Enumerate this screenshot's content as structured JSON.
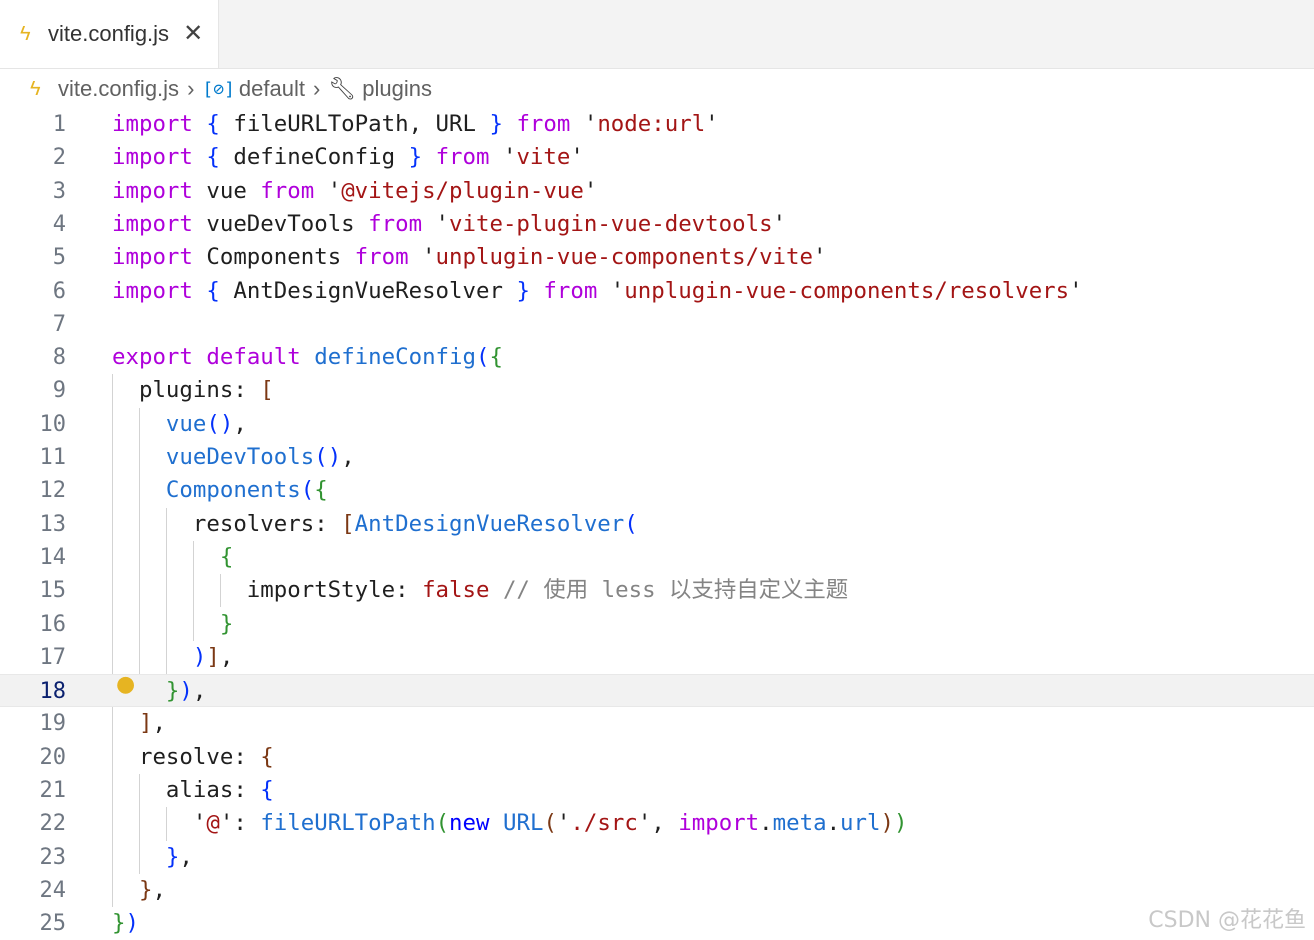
{
  "tab": {
    "label": "vite.config.js",
    "close_glyph": "✕"
  },
  "breadcrumb": {
    "file": "vite.config.js",
    "symbol": "default",
    "member": "plugins"
  },
  "editor": {
    "active_line": 18,
    "lines": [
      [
        [
          "kw",
          "import"
        ],
        [
          "plain",
          " "
        ],
        [
          "br1",
          "{"
        ],
        [
          "plain",
          " fileURLToPath, URL "
        ],
        [
          "br1",
          "}"
        ],
        [
          "plain",
          " "
        ],
        [
          "kw",
          "from"
        ],
        [
          "plain",
          " '"
        ],
        [
          "str",
          "node:url"
        ],
        [
          "plain",
          "'"
        ]
      ],
      [
        [
          "kw",
          "import"
        ],
        [
          "plain",
          " "
        ],
        [
          "br1",
          "{"
        ],
        [
          "plain",
          " defineConfig "
        ],
        [
          "br1",
          "}"
        ],
        [
          "plain",
          " "
        ],
        [
          "kw",
          "from"
        ],
        [
          "plain",
          " '"
        ],
        [
          "str",
          "vite"
        ],
        [
          "plain",
          "'"
        ]
      ],
      [
        [
          "kw",
          "import"
        ],
        [
          "plain",
          " vue "
        ],
        [
          "kw",
          "from"
        ],
        [
          "plain",
          " '"
        ],
        [
          "str",
          "@vitejs/plugin-vue"
        ],
        [
          "plain",
          "'"
        ]
      ],
      [
        [
          "kw",
          "import"
        ],
        [
          "plain",
          " vueDevTools "
        ],
        [
          "kw",
          "from"
        ],
        [
          "plain",
          " '"
        ],
        [
          "str",
          "vite-plugin-vue-devtools"
        ],
        [
          "plain",
          "'"
        ]
      ],
      [
        [
          "kw",
          "import"
        ],
        [
          "plain",
          " Components "
        ],
        [
          "kw",
          "from"
        ],
        [
          "plain",
          " '"
        ],
        [
          "str",
          "unplugin-vue-components/vite"
        ],
        [
          "plain",
          "'"
        ]
      ],
      [
        [
          "kw",
          "import"
        ],
        [
          "plain",
          " "
        ],
        [
          "br1",
          "{"
        ],
        [
          "plain",
          " AntDesignVueResolver "
        ],
        [
          "br1",
          "}"
        ],
        [
          "plain",
          " "
        ],
        [
          "kw",
          "from"
        ],
        [
          "plain",
          " '"
        ],
        [
          "str",
          "unplugin-vue-components/resolvers"
        ],
        [
          "plain",
          "'"
        ]
      ],
      [],
      [
        [
          "kw",
          "export"
        ],
        [
          "plain",
          " "
        ],
        [
          "kw",
          "default"
        ],
        [
          "plain",
          " "
        ],
        [
          "fnb",
          "defineConfig"
        ],
        [
          "br1",
          "("
        ],
        [
          "br2",
          "{"
        ]
      ],
      [
        [
          "plain",
          "  plugins: "
        ],
        [
          "br3",
          "["
        ]
      ],
      [
        [
          "plain",
          "    "
        ],
        [
          "fnb",
          "vue"
        ],
        [
          "br1",
          "()"
        ],
        [
          "plain",
          ","
        ]
      ],
      [
        [
          "plain",
          "    "
        ],
        [
          "fnb",
          "vueDevTools"
        ],
        [
          "br1",
          "()"
        ],
        [
          "plain",
          ","
        ]
      ],
      [
        [
          "plain",
          "    "
        ],
        [
          "fnb",
          "Components"
        ],
        [
          "br1",
          "("
        ],
        [
          "br2",
          "{"
        ]
      ],
      [
        [
          "plain",
          "      resolvers: "
        ],
        [
          "br3",
          "["
        ],
        [
          "fnb",
          "AntDesignVueResolver"
        ],
        [
          "br1",
          "("
        ]
      ],
      [
        [
          "plain",
          "        "
        ],
        [
          "br2",
          "{"
        ]
      ],
      [
        [
          "plain",
          "          importStyle: "
        ],
        [
          "bool",
          "false"
        ],
        [
          "plain",
          " "
        ],
        [
          "cm",
          "// 使用 less 以支持自定义主题"
        ]
      ],
      [
        [
          "plain",
          "        "
        ],
        [
          "br2",
          "}"
        ]
      ],
      [
        [
          "plain",
          "      "
        ],
        [
          "br1",
          ")"
        ],
        [
          "br3",
          "]"
        ],
        [
          "plain",
          ","
        ]
      ],
      [
        [
          "plain",
          "    "
        ],
        [
          "br2",
          "}"
        ],
        [
          "br1",
          ")"
        ],
        [
          "plain",
          ","
        ]
      ],
      [
        [
          "plain",
          "  "
        ],
        [
          "br3",
          "]"
        ],
        [
          "plain",
          ","
        ]
      ],
      [
        [
          "plain",
          "  resolve: "
        ],
        [
          "br3",
          "{"
        ]
      ],
      [
        [
          "plain",
          "    alias: "
        ],
        [
          "br1",
          "{"
        ]
      ],
      [
        [
          "plain",
          "      '"
        ],
        [
          "str",
          "@"
        ],
        [
          "plain",
          "': "
        ],
        [
          "fnb",
          "fileURLToPath"
        ],
        [
          "br2",
          "("
        ],
        [
          "kb",
          "new"
        ],
        [
          "plain",
          " "
        ],
        [
          "fnb",
          "URL"
        ],
        [
          "br3",
          "("
        ],
        [
          "plain",
          "'"
        ],
        [
          "str",
          "./src"
        ],
        [
          "plain",
          "', "
        ],
        [
          "kw",
          "import"
        ],
        [
          "plain",
          "."
        ],
        [
          "fnb",
          "meta"
        ],
        [
          "plain",
          "."
        ],
        [
          "fnb",
          "url"
        ],
        [
          "br3",
          ")"
        ],
        [
          "br2",
          ")"
        ]
      ],
      [
        [
          "plain",
          "    "
        ],
        [
          "br1",
          "}"
        ],
        [
          "plain",
          ","
        ]
      ],
      [
        [
          "plain",
          "  "
        ],
        [
          "br3",
          "}"
        ],
        [
          "plain",
          ","
        ]
      ],
      [
        [
          "br2",
          "}"
        ],
        [
          "br1",
          ")"
        ]
      ]
    ]
  },
  "watermark": "CSDN @花花鱼",
  "icons": {
    "file": "bolt-icon",
    "symbol": "symbol-variable-icon",
    "member": "wrench-icon",
    "lightbulb": "lightbulb-icon"
  }
}
